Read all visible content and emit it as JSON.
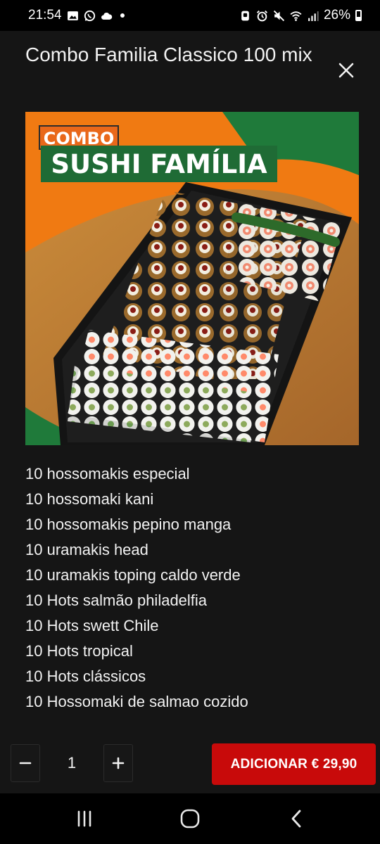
{
  "status_bar": {
    "time": "21:54",
    "battery": "26%",
    "left_icons": [
      "image-icon",
      "whatsapp-icon",
      "cloud-icon",
      "notification-dot"
    ],
    "right_icons": [
      "nfc-icon",
      "alarm-icon",
      "mute-icon",
      "wifi-icon",
      "signal-icon",
      "battery-icon"
    ]
  },
  "product": {
    "title": "Combo Familia Classico 100 mix",
    "image": {
      "banner_line1": "COMBO",
      "banner_line2": "SUSHI FAMÍLIA"
    },
    "items": [
      "10 hossomakis especial",
      "10 hossomaki kani",
      "10 hossomakis pepino manga",
      "10 uramakis head",
      "10 uramakis toping caldo verde",
      "10 Hots salmão philadelfia",
      "10 Hots swett Chile",
      "10 Hots tropical",
      "10 Hots clássicos",
      "10 Hossomaki de salmao cozido"
    ]
  },
  "order": {
    "minus": "−",
    "quantity": "1",
    "plus": "+",
    "add_label": "ADICIONAR € 29,90"
  },
  "colors": {
    "background": "#151515",
    "accent_button": "#c80a0a",
    "banner_orange": "#f07a12",
    "banner_green": "#1f7a3a"
  },
  "nav_bar": {
    "icons": [
      "recent-apps-icon",
      "home-icon",
      "back-icon"
    ]
  }
}
